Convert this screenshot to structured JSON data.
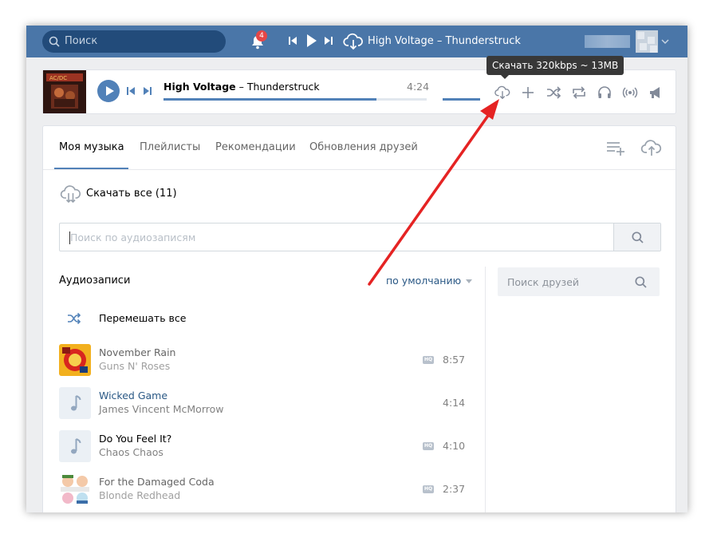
{
  "header": {
    "search_placeholder": "Поиск",
    "notifications_count": "4",
    "now_playing": "High Voltage – Thunderstruck"
  },
  "player": {
    "artist": "High Voltage",
    "separator": " – ",
    "song": "Thunderstruck",
    "time": "4:24",
    "progress": 0.81,
    "tooltip": "Скачать 320kbps ~ 13MB"
  },
  "tabs": [
    {
      "label": "Моя музыка",
      "active": true
    },
    {
      "label": "Плейлисты",
      "active": false
    },
    {
      "label": "Рекомендации",
      "active": false
    },
    {
      "label": "Обновления друзей",
      "active": false
    }
  ],
  "download_all": "Скачать все (11)",
  "audio_search_placeholder": "Поиск по аудиозаписям",
  "list": {
    "heading": "Аудиозаписи",
    "sort": "по умолчанию",
    "shuffle_all": "Перемешать все"
  },
  "tracks": [
    {
      "title": "November Rain",
      "artist": "Guns N' Roses",
      "duration": "8:57",
      "hq": "HQ"
    },
    {
      "title": "Wicked Game",
      "artist": "James Vincent McMorrow",
      "duration": "4:14",
      "hq": ""
    },
    {
      "title": "Do You Feel It?",
      "artist": "Chaos Chaos",
      "duration": "4:10",
      "hq": "HQ"
    },
    {
      "title": "For the Damaged Coda",
      "artist": "Blonde Redhead",
      "duration": "2:37",
      "hq": "HQ"
    }
  ],
  "friends_search_placeholder": "Поиск друзей",
  "colors": {
    "brand": "#4a76a8",
    "accent": "#5181b8",
    "link": "#2a5885",
    "arrow": "#e52323"
  }
}
